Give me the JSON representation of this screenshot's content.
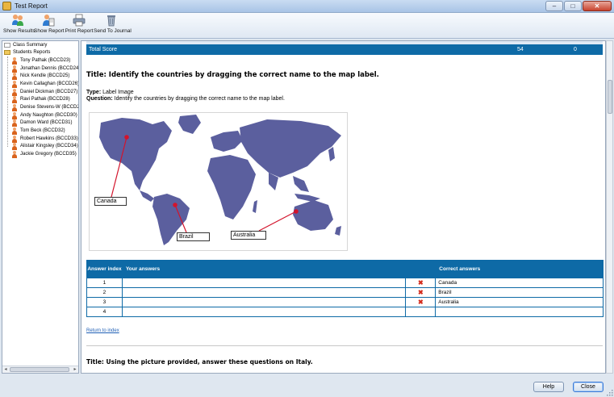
{
  "window": {
    "title": "Test Report",
    "minimize": "–",
    "maximize": "□",
    "close": "✕"
  },
  "toolbar": {
    "items": [
      {
        "label": "Show Results",
        "icon": "show-results-icon"
      },
      {
        "label": "Show Report",
        "icon": "show-report-icon"
      },
      {
        "label": "Print Report",
        "icon": "printer-icon"
      },
      {
        "label": "Send To Journal",
        "icon": "journal-bin-icon"
      }
    ]
  },
  "sidebar": {
    "class_summary": "Class Summary",
    "students_reports": "Students Reports",
    "students": [
      "Tony Pathak (BCCD23)",
      "Jonathan Dennis (BCCD24)",
      "Nick Kendle (BCCD25)",
      "Kevin Callaghan (BCCD26)",
      "Daniel Dickman (BCCD27)",
      "Ravi Pathak (BCCD28)",
      "Denise Stevens-W (BCCD29)",
      "Andy Naughton (BCCD30)",
      "Damon Ward (BCCD31)",
      "Tom Beck (BCCD32)",
      "Robert Hawkins (BCCD33)",
      "Alistair Kingsley (BCCD34)",
      "Jackie Gregory (BCCD35)"
    ]
  },
  "report": {
    "total_score_label": "Total Score",
    "total_score_value": "54",
    "total_score_second": "0",
    "question1": {
      "title": "Title: Identify the countries by dragging the correct name to the map label.",
      "type_label": "Type:",
      "type_value": "Label Image",
      "question_label": "Question:",
      "question_value": "Identify the countries by dragging the correct name to the map label.",
      "map_labels": [
        "Canada",
        "Brazil",
        "Australia"
      ]
    },
    "answers_table": {
      "headers": {
        "index": "Answer index",
        "yours": "Your answers",
        "correct": "Correct answers"
      },
      "rows": [
        {
          "index": "1",
          "yours": "",
          "wrong_mark": "✖",
          "correct": "Canada"
        },
        {
          "index": "2",
          "yours": "",
          "wrong_mark": "✖",
          "correct": "Brazil"
        },
        {
          "index": "3",
          "yours": "",
          "wrong_mark": "✖",
          "correct": "Australia"
        },
        {
          "index": "4",
          "yours": "",
          "wrong_mark": "",
          "correct": ""
        }
      ]
    },
    "return_link": "Return to index",
    "question2_title": "Title: Using the picture provided, answer these questions on Italy."
  },
  "footer": {
    "help": "Help",
    "close": "Close"
  },
  "colors": {
    "table_header": "#0e6aa6",
    "map_land": "#5b5f9e",
    "marker": "#d3142c",
    "wrong_mark": "#d32c1d"
  }
}
